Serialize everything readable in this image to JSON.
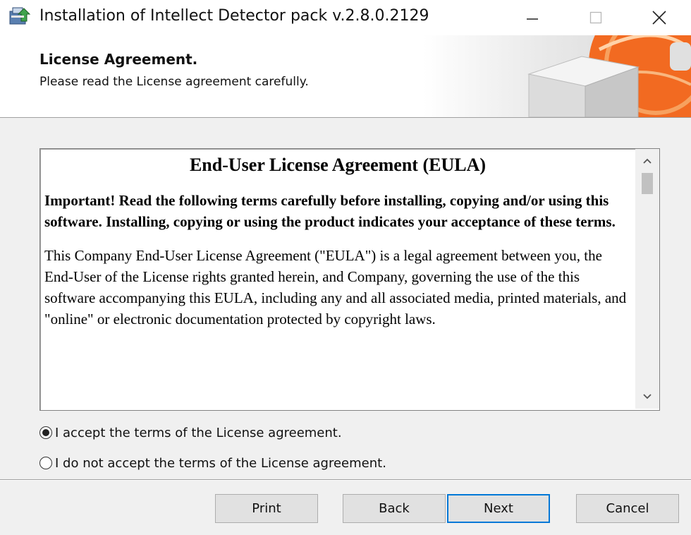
{
  "window": {
    "title": "Installation of Intellect Detector pack v.2.8.0.2129",
    "controls": {
      "minimize": "minimize-icon",
      "maximize": "maximize-icon",
      "close": "close-icon"
    }
  },
  "header": {
    "title": "License Agreement.",
    "subtitle": "Please read the License agreement carefully.",
    "banner_colors": {
      "accent": "#f26a21",
      "box": "#e8e8e8"
    }
  },
  "eula": {
    "heading": "End-User License Agreement (EULA)",
    "important": "Important! Read the following terms carefully before installing, copying and/or using this software. Installing, copying or using the product indicates your acceptance of these terms.",
    "paragraph": "This Company End-User License Agreement (\"EULA\") is a legal agreement between you, the End-User of the License rights granted herein, and Company, governing the use of the this software accompanying this EULA, including any and all associated media, printed materials, and \"online\" or electronic documentation protected by copyright laws."
  },
  "options": {
    "accept": {
      "label": "I accept the terms of the License agreement.",
      "checked": true
    },
    "decline": {
      "label": "I do not accept the terms of the License agreement.",
      "checked": false
    }
  },
  "buttons": {
    "print": "Print",
    "back": "Back",
    "next": "Next",
    "cancel": "Cancel"
  },
  "colors": {
    "default_button_border": "#0078d7",
    "dialog_background": "#f0f0f0"
  }
}
